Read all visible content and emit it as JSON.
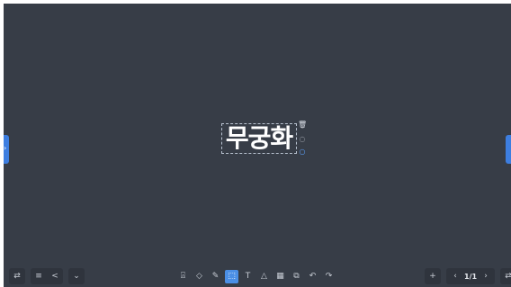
{
  "canvas": {
    "background": "#373d47"
  },
  "text_box": {
    "content": "무궁화"
  },
  "selection_tools": [
    {
      "icon": "trash-icon"
    },
    {
      "icon": "palette-icon"
    },
    {
      "icon": "search-icon"
    }
  ],
  "left_controls": [
    {
      "icon": "switch-icon",
      "glyph": "⇄"
    },
    {
      "icon": "menu-icon",
      "glyph": "≡"
    },
    {
      "icon": "share-icon",
      "glyph": "<"
    },
    {
      "icon": "chevron-down-icon",
      "glyph": "⌄"
    }
  ],
  "toolbar": [
    {
      "icon": "lock-icon",
      "glyph": "⍓",
      "active": false
    },
    {
      "icon": "eraser-icon",
      "glyph": "◇",
      "active": false
    },
    {
      "icon": "pen-icon",
      "glyph": "✎",
      "active": false
    },
    {
      "icon": "select-icon",
      "glyph": "⬚",
      "active": true
    },
    {
      "icon": "text-icon",
      "glyph": "T",
      "active": false
    },
    {
      "icon": "shape-icon",
      "glyph": "△",
      "active": false
    },
    {
      "icon": "table-icon",
      "glyph": "▦",
      "active": false
    },
    {
      "icon": "toolbox-icon",
      "glyph": "⧉",
      "active": false
    },
    {
      "icon": "undo-icon",
      "glyph": "↶",
      "active": false
    },
    {
      "icon": "redo-icon",
      "glyph": "↷",
      "active": false
    }
  ],
  "right_controls": {
    "add_glyph": "+",
    "prev_glyph": "‹",
    "page_indicator": "1/1",
    "next_glyph": "›",
    "switch_glyph": "⇄"
  }
}
